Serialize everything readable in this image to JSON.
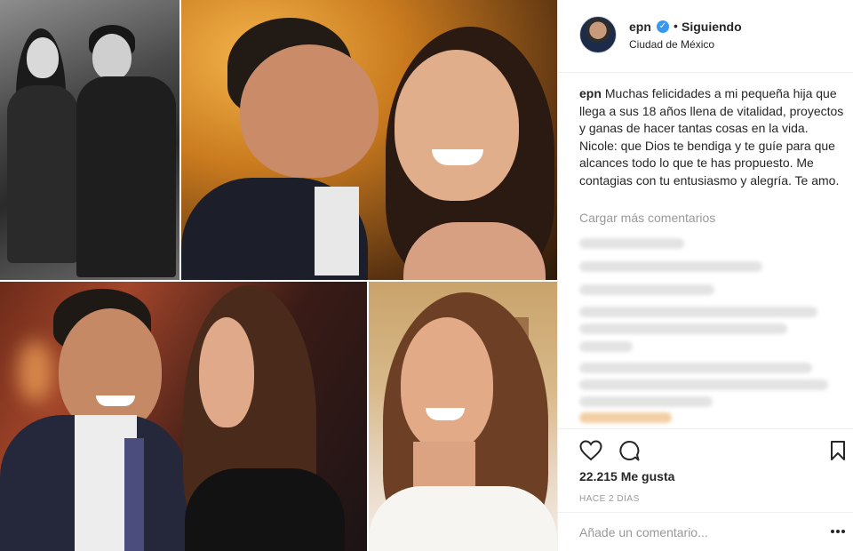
{
  "post": {
    "username": "epn",
    "verified_icon": "verified-badge-icon",
    "follow_separator": "•",
    "follow_status": "Siguiendo",
    "location": "Ciudad de México",
    "caption_user": "epn",
    "caption_text": "Muchas felicidades a mi pequeña hija que llega a sus 18 años llena de vitalidad, proyectos y ganas de hacer tantas cosas en la vida. Nicole: que Dios te bendiga y te guíe para que alcances todo lo que te has propuesto. Me contagias con tu entusiasmo y alegría. Te amo.",
    "load_more": "Cargar más comentarios",
    "likes": "22.215 Me gusta",
    "time_ago": "Hace 2 días",
    "add_comment_placeholder": "Añade un comentario..."
  },
  "icons": {
    "like": "heart-icon",
    "comment": "comment-icon",
    "save": "bookmark-icon",
    "more": "more-options-icon"
  },
  "colors": {
    "text": "#262626",
    "muted": "#999999",
    "verified": "#3897f0",
    "divider": "#efefef"
  }
}
